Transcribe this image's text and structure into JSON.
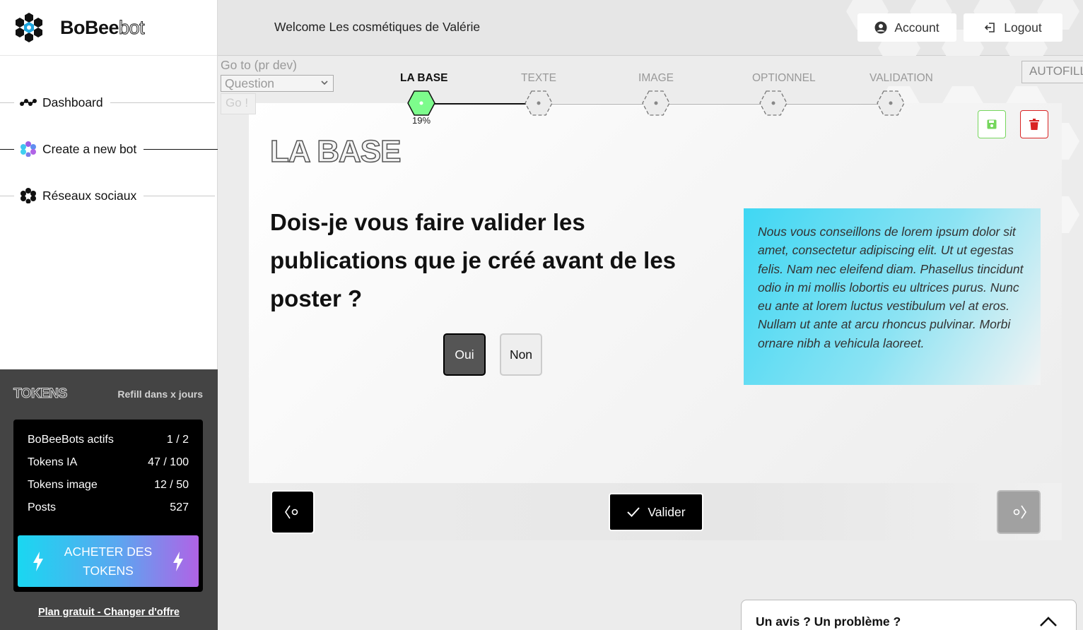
{
  "brand": {
    "name_bold": "BoBee",
    "name_thin": "bot"
  },
  "nav": [
    {
      "label": "Dashboard"
    },
    {
      "label": "Create a new bot"
    },
    {
      "label": "Réseaux sociaux"
    }
  ],
  "tokens": {
    "title": "TOKENS",
    "refill": "Refill dans x jours",
    "rows": [
      {
        "label": "BoBeeBots actifs",
        "value": "1 / 2"
      },
      {
        "label": "Tokens IA",
        "value": "47 / 100"
      },
      {
        "label": "Tokens image",
        "value": "12 / 50"
      },
      {
        "label": "Posts",
        "value": "527"
      }
    ],
    "buy_label": "ACHETER DES TOKENS",
    "plan_link": "Plan gratuit - Changer d'offre"
  },
  "header": {
    "welcome": "Welcome Les cosmétiques de Valérie",
    "account": "Account",
    "logout": "Logout"
  },
  "dev": {
    "label": "Go to (pr dev)",
    "select_value": "Question",
    "go": "Go !",
    "autofill": "AUTOFILL"
  },
  "stepper": {
    "steps": [
      {
        "label": "LA BASE",
        "state": "current"
      },
      {
        "label": "TEXTE",
        "state": "pending"
      },
      {
        "label": "IMAGE",
        "state": "pending"
      },
      {
        "label": "OPTIONNEL",
        "state": "pending"
      },
      {
        "label": "VALIDATION",
        "state": "pending"
      }
    ],
    "progress": "19%"
  },
  "card": {
    "title": "LA BASE",
    "question": "Dois-je vous faire valider les publications que je créé avant de les poster ?",
    "yes": "Oui",
    "no": "Non",
    "tip": "Nous vous conseillons de lorem ipsum dolor sit amet, consectetur adipiscing elit. Ut ut egestas felis. Nam nec eleifend diam. Phasellus tincidunt odio in mi mollis lobortis eu ultrices purus. Nunc eu ante at lorem luctus vestibulum vel at eros. Nullam ut ante at arcu rhoncus pulvinar. Morbi ornare nibh a vehicula laoreet."
  },
  "footer": {
    "validate": "Valider"
  },
  "feedback": {
    "label": "Un avis ? Un problème ?"
  },
  "colors": {
    "accent_green": "#7dfc8c",
    "save_green": "#75d65c",
    "delete_red": "#d92323"
  }
}
